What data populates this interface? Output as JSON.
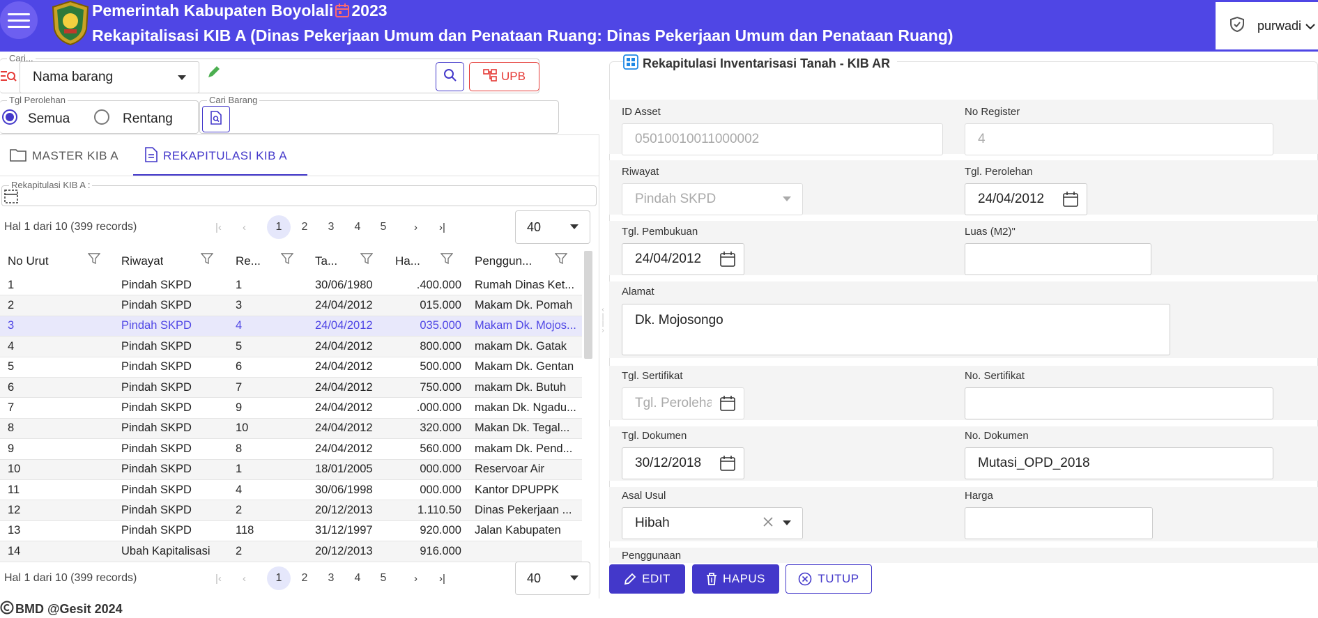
{
  "header": {
    "title_line1_a": "Pemerintah Kabupaten Boyolali",
    "title_line1_b": "2023",
    "title_line2": "Rekapitalisasi KIB A  (Dinas Pekerjaan Umum dan Penataan Ruang: Dinas Pekerjaan Umum dan Penataan Ruang)",
    "username": "purwadi",
    "accent": "#4f46e5"
  },
  "search": {
    "legend": "Cari...",
    "field_select": "Nama barang",
    "query_value": "",
    "upb_label": "UPB",
    "date_legend": "Tgl Perolehan",
    "radio_all": "Semua",
    "radio_range": "Rentang",
    "cari_barang_legend": "Cari Barang"
  },
  "tabs": [
    {
      "label": "MASTER KIB A"
    },
    {
      "label": "REKAPITULASI KIB A"
    }
  ],
  "rekap_legend": "Rekapitulasi KIB A :",
  "pagination": {
    "info": "Hal 1 dari 10 (399 records)",
    "pages": [
      "1",
      "2",
      "3",
      "4",
      "5"
    ],
    "page_size": "40"
  },
  "table": {
    "columns": [
      "No Urut",
      "Riwayat",
      "Re...",
      "Ta...",
      "Ha...",
      "Penggun..."
    ],
    "rows": [
      [
        "1",
        "Pindah SKPD",
        "1",
        "30/06/1980",
        ".400.000",
        "Rumah Dinas Ket..."
      ],
      [
        "2",
        "Pindah SKPD",
        "3",
        "24/04/2012",
        "015.000",
        "Makam Dk. Pomah"
      ],
      [
        "3",
        "Pindah SKPD",
        "4",
        "24/04/2012",
        "035.000",
        "Makam Dk. Mojos..."
      ],
      [
        "4",
        "Pindah SKPD",
        "5",
        "24/04/2012",
        "800.000",
        "makam Dk. Gatak"
      ],
      [
        "5",
        "Pindah SKPD",
        "6",
        "24/04/2012",
        "500.000",
        "Makam Dk. Gentan"
      ],
      [
        "6",
        "Pindah SKPD",
        "7",
        "24/04/2012",
        "750.000",
        "makam Dk. Butuh"
      ],
      [
        "7",
        "Pindah SKPD",
        "9",
        "24/04/2012",
        ".000.000",
        "makan Dk. Ngadu..."
      ],
      [
        "8",
        "Pindah SKPD",
        "10",
        "24/04/2012",
        "320.000",
        "Makan Dk. Tegal..."
      ],
      [
        "9",
        "Pindah SKPD",
        "8",
        "24/04/2012",
        "560.000",
        "makam Dk. Pend..."
      ],
      [
        "10",
        "Pindah SKPD",
        "1",
        "18/01/2005",
        "000.000",
        "Reservoar Air"
      ],
      [
        "11",
        "Pindah SKPD",
        "4",
        "30/06/1998",
        "000.000",
        "Kantor DPUPPK"
      ],
      [
        "12",
        "Pindah SKPD",
        "2",
        "20/12/2013",
        "1.110.50",
        "Dinas Pekerjaan ..."
      ],
      [
        "13",
        "Pindah SKPD",
        "118",
        "31/12/1997",
        "920.000",
        "Jalan Kabupaten"
      ],
      [
        "14",
        "Ubah Kapitalisasi",
        "2",
        "20/12/2013",
        "916.000",
        ""
      ]
    ]
  },
  "detail": {
    "title": "Rekapitulasi Inventarisasi Tanah - KIB AR",
    "id_asset_label": "ID Asset",
    "id_asset": "05010010011000002",
    "no_register_label": "No Register",
    "no_register": "4",
    "riwayat_label": "Riwayat",
    "riwayat": "Pindah SKPD",
    "tgl_perolehan_label": "Tgl. Perolehan",
    "tgl_perolehan": "24/04/2012",
    "tgl_pembukuan_label": "Tgl. Pembukuan",
    "tgl_pembukuan": "24/04/2012",
    "luas_label": "Luas (M2)\"",
    "luas": "",
    "alamat_label": "Alamat",
    "alamat": "Dk. Mojosongo",
    "tgl_sertifikat_label": "Tgl. Sertifikat",
    "tgl_sertifikat_placeholder": "Tgl. Peroleha",
    "no_sertifikat_label": "No. Sertifikat",
    "no_sertifikat": "",
    "tgl_dokumen_label": "Tgl. Dokumen",
    "tgl_dokumen": "30/12/2018",
    "no_dokumen_label": "No. Dokumen",
    "no_dokumen": "Mutasi_OPD_2018",
    "asal_usul_label": "Asal Usul",
    "asal_usul": "Hibah",
    "harga_label": "Harga",
    "harga": "",
    "penggunaan_label": "Penggunaan"
  },
  "buttons": {
    "edit": "EDIT",
    "hapus": "HAPUS",
    "tutup": "TUTUP"
  },
  "footer": "BMD @Gesit 2024"
}
